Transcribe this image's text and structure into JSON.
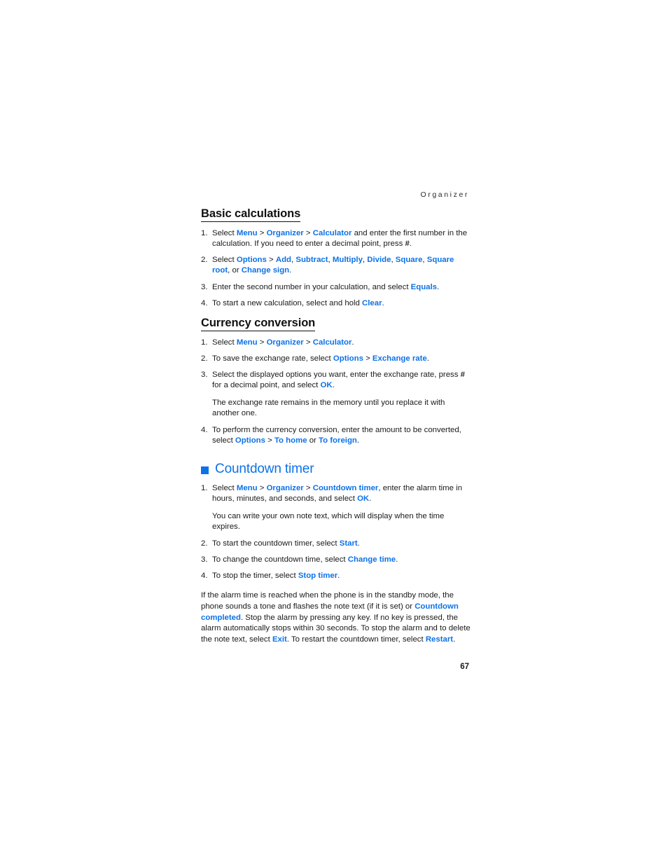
{
  "document": {
    "running_header": "Organizer",
    "page_number": "67",
    "accent_color": "#0c72e8",
    "text_color": "#1a1a1a"
  },
  "sections": {
    "basic_calculations": {
      "heading": "Basic calculations",
      "steps": [
        {
          "number": "1.",
          "parts": [
            {
              "t": "Select ",
              "s": "plain"
            },
            {
              "t": "Menu",
              "s": "ui"
            },
            {
              "t": " > ",
              "s": "sep"
            },
            {
              "t": "Organizer",
              "s": "ui"
            },
            {
              "t": " > ",
              "s": "sep"
            },
            {
              "t": "Calculator",
              "s": "ui"
            },
            {
              "t": " and enter the first number in the calculation. If you need to enter a decimal point, press ",
              "s": "plain"
            },
            {
              "t": "#",
              "s": "bold"
            },
            {
              "t": ".",
              "s": "plain"
            }
          ]
        },
        {
          "number": "2.",
          "parts": [
            {
              "t": "Select ",
              "s": "plain"
            },
            {
              "t": "Options",
              "s": "ui"
            },
            {
              "t": " > ",
              "s": "sep"
            },
            {
              "t": "Add",
              "s": "ui"
            },
            {
              "t": ", ",
              "s": "plain"
            },
            {
              "t": "Subtract",
              "s": "ui"
            },
            {
              "t": ", ",
              "s": "plain"
            },
            {
              "t": "Multiply",
              "s": "ui"
            },
            {
              "t": ", ",
              "s": "plain"
            },
            {
              "t": "Divide",
              "s": "ui"
            },
            {
              "t": ", ",
              "s": "plain"
            },
            {
              "t": "Square",
              "s": "ui"
            },
            {
              "t": ", ",
              "s": "plain"
            },
            {
              "t": "Square root",
              "s": "ui"
            },
            {
              "t": ", or ",
              "s": "plain"
            },
            {
              "t": "Change sign",
              "s": "ui"
            },
            {
              "t": ".",
              "s": "plain"
            }
          ]
        },
        {
          "number": "3.",
          "parts": [
            {
              "t": "Enter the second number in your calculation, and select ",
              "s": "plain"
            },
            {
              "t": "Equals",
              "s": "ui"
            },
            {
              "t": ".",
              "s": "plain"
            }
          ]
        },
        {
          "number": "4.",
          "parts": [
            {
              "t": "To start a new calculation, select and hold ",
              "s": "plain"
            },
            {
              "t": "Clear",
              "s": "ui"
            },
            {
              "t": ".",
              "s": "plain"
            }
          ]
        }
      ]
    },
    "currency_conversion": {
      "heading": "Currency conversion",
      "steps": [
        {
          "number": "1.",
          "parts": [
            {
              "t": "Select ",
              "s": "plain"
            },
            {
              "t": "Menu",
              "s": "ui"
            },
            {
              "t": " > ",
              "s": "sep"
            },
            {
              "t": "Organizer",
              "s": "ui"
            },
            {
              "t": " > ",
              "s": "sep"
            },
            {
              "t": "Calculator",
              "s": "ui"
            },
            {
              "t": ".",
              "s": "plain"
            }
          ]
        },
        {
          "number": "2.",
          "parts": [
            {
              "t": "To save the exchange rate, select ",
              "s": "plain"
            },
            {
              "t": "Options",
              "s": "ui"
            },
            {
              "t": " > ",
              "s": "sep"
            },
            {
              "t": "Exchange rate",
              "s": "ui"
            },
            {
              "t": ".",
              "s": "plain"
            }
          ]
        },
        {
          "number": "3.",
          "parts": [
            {
              "t": "Select the displayed options you want, enter the exchange rate, press ",
              "s": "plain"
            },
            {
              "t": "#",
              "s": "bold"
            },
            {
              "t": " for a decimal point, and select ",
              "s": "plain"
            },
            {
              "t": "OK",
              "s": "ui"
            },
            {
              "t": ".",
              "s": "plain"
            }
          ]
        }
      ],
      "note": "The exchange rate remains in the memory until you replace it with another one.",
      "last_step": {
        "number": "4.",
        "parts": [
          {
            "t": "To perform the currency conversion, enter the amount to be converted, select ",
            "s": "plain"
          },
          {
            "t": "Options",
            "s": "ui"
          },
          {
            "t": " > ",
            "s": "sep"
          },
          {
            "t": "To home",
            "s": "ui"
          },
          {
            "t": " or ",
            "s": "plain"
          },
          {
            "t": "To foreign",
            "s": "ui"
          },
          {
            "t": ".",
            "s": "plain"
          }
        ]
      }
    },
    "countdown_timer": {
      "heading": "Countdown timer",
      "bullet_icon": "blue-square-bullet",
      "step_one": {
        "number": "1.",
        "parts": [
          {
            "t": "Select ",
            "s": "plain"
          },
          {
            "t": "Menu",
            "s": "ui"
          },
          {
            "t": " > ",
            "s": "sep"
          },
          {
            "t": "Organizer",
            "s": "ui"
          },
          {
            "t": " > ",
            "s": "sep"
          },
          {
            "t": "Countdown timer",
            "s": "ui"
          },
          {
            "t": ", enter the alarm time in hours, minutes, and seconds, and select ",
            "s": "plain"
          },
          {
            "t": "OK",
            "s": "ui"
          },
          {
            "t": ".",
            "s": "plain"
          }
        ]
      },
      "note": "You can write your own note text, which will display when the time expires.",
      "steps_rest": [
        {
          "number": "2.",
          "parts": [
            {
              "t": "To start the countdown timer, select ",
              "s": "plain"
            },
            {
              "t": "Start",
              "s": "ui"
            },
            {
              "t": ".",
              "s": "plain"
            }
          ]
        },
        {
          "number": "3.",
          "parts": [
            {
              "t": "To change the countdown time, select ",
              "s": "plain"
            },
            {
              "t": "Change time",
              "s": "ui"
            },
            {
              "t": ".",
              "s": "plain"
            }
          ]
        },
        {
          "number": "4.",
          "parts": [
            {
              "t": "To stop the timer, select ",
              "s": "plain"
            },
            {
              "t": "Stop timer",
              "s": "ui"
            },
            {
              "t": ".",
              "s": "plain"
            }
          ]
        }
      ],
      "closing_paragraph": [
        {
          "t": "If the alarm time is reached when the phone is in the standby mode, the phone sounds a tone and flashes the note text (if it is set) or ",
          "s": "plain"
        },
        {
          "t": "Countdown completed",
          "s": "ui"
        },
        {
          "t": ". Stop the alarm by pressing any key. If no key is pressed, the alarm automatically stops within 30 seconds. To stop the alarm and to delete the note text, select ",
          "s": "plain"
        },
        {
          "t": "Exit",
          "s": "ui"
        },
        {
          "t": ". To restart the countdown timer, select ",
          "s": "plain"
        },
        {
          "t": "Restart",
          "s": "ui"
        },
        {
          "t": ".",
          "s": "plain"
        }
      ]
    }
  }
}
